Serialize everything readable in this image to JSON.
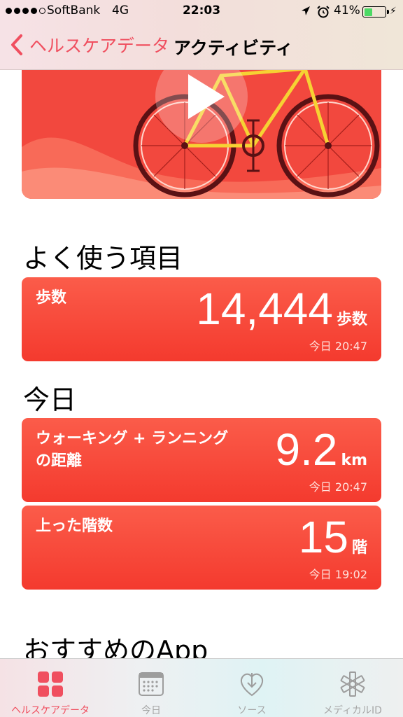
{
  "status_bar": {
    "carrier": "SoftBank",
    "network": "4G",
    "time": "22:03",
    "battery": "41%",
    "battery_level": 0.41,
    "signal_bars": 4,
    "icons": [
      "location-arrow-icon",
      "alarm-clock-icon",
      "charging-bolt-icon"
    ]
  },
  "nav": {
    "back_label": "ヘルスケアデータ",
    "title": "アクティビティ"
  },
  "hero": {
    "play_icon": "play-icon",
    "illustration": "bicycle"
  },
  "sections": {
    "favorites_title": "よく使う項目",
    "today_title": "今日",
    "apps_title": "おすすめのApp"
  },
  "cards": {
    "steps": {
      "label": "歩数",
      "value": "14,444",
      "unit": "歩数",
      "time": "今日 20:47"
    },
    "distance": {
      "label_line1": "ウォーキング + ランニング",
      "label_line2": "の距離",
      "value": "9.2",
      "unit": "km",
      "time": "今日 20:47"
    },
    "floors": {
      "label": "上った階数",
      "value": "15",
      "unit": "階",
      "time": "今日 19:02"
    }
  },
  "tabbar": {
    "items": [
      {
        "label": "ヘルスケアデータ",
        "icon": "grid-icon",
        "active": true
      },
      {
        "label": "今日",
        "icon": "calendar-icon",
        "active": false
      },
      {
        "label": "ソース",
        "icon": "heart-download-icon",
        "active": false
      },
      {
        "label": "メディカルID",
        "icon": "medical-star-icon",
        "active": false
      }
    ]
  },
  "colors": {
    "accent": "#f04f5f",
    "card": "#f7473a"
  }
}
